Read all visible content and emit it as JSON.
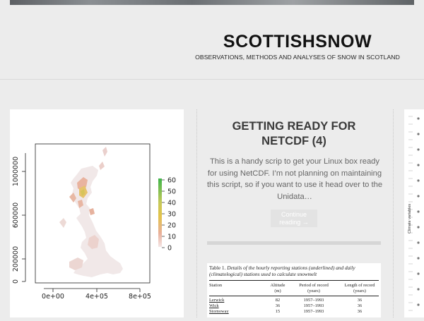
{
  "site": {
    "title": "SCOTTISHSNOW",
    "tagline": "OBSERVATIONS, METHODS AND ANALYSES OF SNOW IN SCOTLAND"
  },
  "post": {
    "title": "GETTING READY FOR NETCDF (4)",
    "excerpt": "This is a handy scrip to get your Linux box ready for using NetCDF. I’m not planning on maintaining this script, so if you want to use it head over to the Unidata…",
    "continue_label": "Continue reading →"
  },
  "map_plot": {
    "y_ticks": [
      "0",
      "200000",
      "600000",
      "1000000"
    ],
    "x_ticks": [
      "0e+00",
      "4e+05",
      "8e+05"
    ],
    "legend_ticks": [
      "60",
      "50",
      "40",
      "30",
      "20",
      "10",
      "0"
    ],
    "colors": {
      "high": "#3fb54a",
      "mid": "#e3c34a",
      "low": "#e9b09b",
      "zero": "#f4e6e6"
    }
  },
  "table_preview": {
    "caption_label": "Table 1.",
    "caption_text": "Details of the hourly reporting stations (underlined) and daily (climatological) stations used to calculate snowmelt",
    "columns": [
      {
        "name": "Station"
      },
      {
        "name": "Altitude",
        "unit": "(m)"
      },
      {
        "name": "Period of record",
        "unit": "(years)"
      },
      {
        "name": "Length of record",
        "unit": "(years)"
      }
    ],
    "rows": [
      {
        "station": "Lerwick",
        "altitude": "82",
        "period": "1957–1993",
        "length": "36"
      },
      {
        "station": "Wick",
        "altitude": "36",
        "period": "1957–1993",
        "length": "36"
      },
      {
        "station": "Stornoway",
        "altitude": "15",
        "period": "1957–1993",
        "length": "36"
      }
    ]
  },
  "right_card": {
    "axis_label": "Climate variables"
  }
}
